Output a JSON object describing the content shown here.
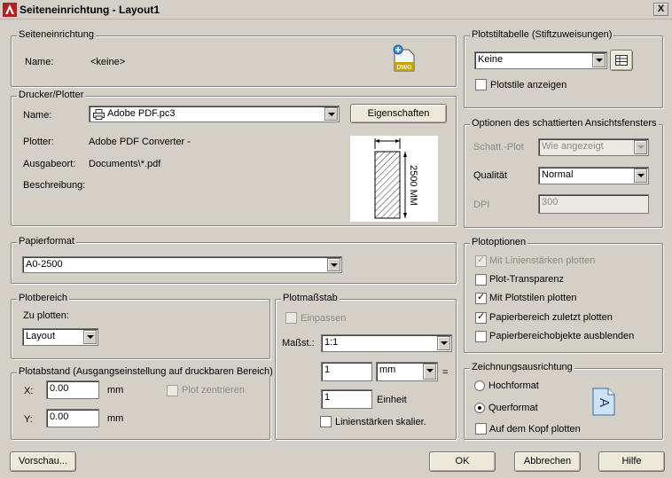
{
  "window": {
    "title": "Seiteneinrichtung - Layout1",
    "close_glyph": "X"
  },
  "page_setup": {
    "group_title": "Seiteneinrichtung",
    "name_label": "Name:",
    "name_value": "<keine>",
    "dwg_icon_label": "DWG"
  },
  "printer": {
    "group_title": "Drucker/Plotter",
    "name_label": "Name:",
    "name_value": "Adobe PDF.pc3",
    "properties_button": "Eigenschaften",
    "plotter_label": "Plotter:",
    "plotter_value": "Adobe PDF Converter -",
    "location_label": "Ausgabeort:",
    "location_value": "Documents\\*.pdf",
    "description_label": "Beschreibung:",
    "preview_dimension": "2500 MM"
  },
  "paper_size": {
    "group_title": "Papierformat",
    "value": "A0-2500"
  },
  "plot_area": {
    "group_title": "Plotbereich",
    "what_label": "Zu plotten:",
    "what_value": "Layout"
  },
  "plot_offset": {
    "group_title": "Plotabstand (Ausgangseinstellung auf druckbaren Bereich)",
    "x_label": "X:",
    "x_value": "0.00",
    "x_unit": "mm",
    "y_label": "Y:",
    "y_value": "0.00",
    "y_unit": "mm",
    "center_label": "Plot zentrieren"
  },
  "plot_scale": {
    "group_title": "Plotmaßstab",
    "fit_label": "Einpassen",
    "scale_label": "Maßst.:",
    "scale_value": "1:1",
    "num_value": "1",
    "unit_value": "mm",
    "equals": "=",
    "unit_num_value": "1",
    "unit_label": "Einheit",
    "lineweights_label": "Linienstärken skalier."
  },
  "plot_style_table": {
    "group_title": "Plotstiltabelle (Stiftzuweisungen)",
    "value": "Keine",
    "display_label": "Plotstile anzeigen"
  },
  "shaded_viewport": {
    "group_title": "Optionen des schattierten Ansichtsfensters",
    "shade_label": "Schatt.-Plot",
    "shade_value": "Wie angezeigt",
    "quality_label": "Qualität",
    "quality_value": "Normal",
    "dpi_label": "DPI",
    "dpi_value": "300"
  },
  "plot_options": {
    "group_title": "Plotoptionen",
    "items": [
      {
        "label": "Mit Linienstärken plotten",
        "checked": true,
        "disabled": true
      },
      {
        "label": "Plot-Transparenz",
        "checked": false,
        "disabled": false
      },
      {
        "label": "Mit Plotstilen plotten",
        "checked": true,
        "disabled": false
      },
      {
        "label": "Papierbereich zuletzt plotten",
        "checked": true,
        "disabled": false
      },
      {
        "label": "Papierbereichobjekte ausblenden",
        "checked": false,
        "disabled": false
      }
    ]
  },
  "orientation": {
    "group_title": "Zeichnungsausrichtung",
    "portrait_label": "Hochformat",
    "landscape_label": "Querformat",
    "selected": "Querformat",
    "upside_down_label": "Auf dem Kopf plotten",
    "icon_letter": "A"
  },
  "footer": {
    "preview_button": "Vorschau...",
    "ok_button": "OK",
    "cancel_button": "Abbrechen",
    "help_button": "Hilfe"
  },
  "tick_glyph": "✓"
}
